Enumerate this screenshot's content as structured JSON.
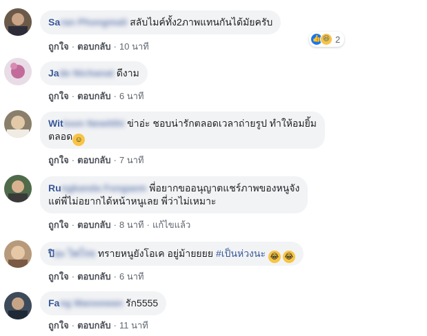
{
  "comments": [
    {
      "name_visible": "Sa",
      "name_blurred": "ran Phongmali",
      "text": "สลับไมค์ทั้ง2ภาพแทนกันได้มัยครับ",
      "actions": {
        "like": "ถูกใจ",
        "reply": "ตอบกลับ",
        "time": "10 นาที"
      },
      "reactions": {
        "count": "2",
        "icons": [
          "like-icon",
          "haha-icon"
        ]
      }
    },
    {
      "name_visible": "Ja",
      "name_blurred": "de Nichanat",
      "text": "ดีงาม",
      "actions": {
        "like": "ถูกใจ",
        "reply": "ตอบกลับ",
        "time": "6 นาที"
      }
    },
    {
      "name_visible": "Wit",
      "name_blurred": "toon Newitthi",
      "text_line1": "ข่าอ่ะ ชอบน่ารักตลอดเวลาถ่ายรูป ทำให้อมยิ้ม",
      "text_line2": "ตลอด",
      "emoji": "smiling-face-emoji",
      "actions": {
        "like": "ถูกใจ",
        "reply": "ตอบกลับ",
        "time": "7 นาที"
      }
    },
    {
      "name_visible": "Ru",
      "name_blurred": "ngkanda Fongaem",
      "text_line1": "พี่อยากขออนุญาตแชร์ภาพของหนูจัง",
      "text_line2": "แต่พี่ไม่อยากได้หน้าหนูเลย พี่ว่าไม่เหมาะ",
      "actions": {
        "like": "ถูกใจ",
        "reply": "ตอบกลับ",
        "time": "8 นาที",
        "edited": "แก้ไขแล้ว"
      }
    },
    {
      "name_visible": "ปิ",
      "name_blurred": "ยะ ไพโรจ",
      "text": "ทรายหนูยังโอเค อยู่ม้ายยยย",
      "hashtag": "#เป็นห่วงนะ",
      "emoji": "tears-of-joy-emoji",
      "actions": {
        "like": "ถูกใจ",
        "reply": "ตอบกลับ",
        "time": "6 นาที"
      }
    },
    {
      "name_visible": "Fa",
      "name_blurred": "ng Maneewan",
      "text": "รัก5555",
      "actions": {
        "like": "ถูกใจ",
        "reply": "ตอบกลับ",
        "time": "11 นาที"
      }
    }
  ],
  "colors": {
    "name": "#385898",
    "bubble": "#f2f3f5",
    "meta": "#606770"
  }
}
